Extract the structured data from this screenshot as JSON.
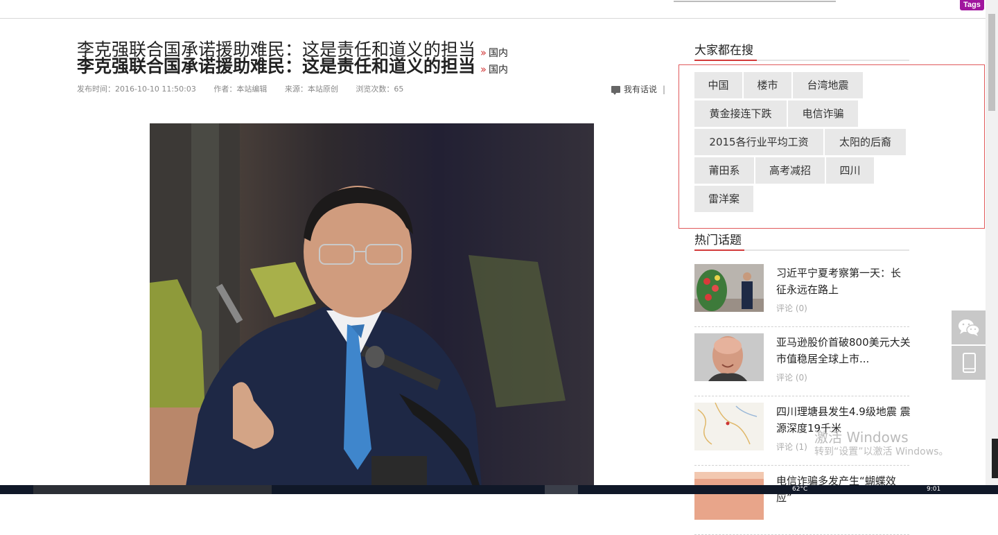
{
  "topbar": {
    "tags_label": "Tags"
  },
  "article": {
    "title": "李克强联合国承诺援助难民：这是责任和道义的担当",
    "category_label": "国内",
    "meta": {
      "publish_time": "发布时间：2016-10-10 11:50:03",
      "author": "作者：本站编辑",
      "source": "来源：本站原创",
      "views": "浏览次数：65"
    },
    "comment_link": "我有话说",
    "comment_sep": "|"
  },
  "sidebar": {
    "hot_search_title": "大家都在搜",
    "hot_tags": [
      "中国",
      "楼市",
      "台湾地震",
      "黄金接连下跌",
      "电信诈骗",
      "2015各行业平均工资",
      "太阳的后裔",
      "莆田系",
      "高考减招",
      "四川",
      "雷洋案"
    ],
    "hot_topics_title": "热门话题",
    "news": [
      {
        "headline": "习近平宁夏考察第一天：长征永远在路上",
        "comments": "评论 (0)"
      },
      {
        "headline": "亚马逊股价首破800美元大关 市值稳居全球上市...",
        "comments": "评论 (0)"
      },
      {
        "headline": "四川理塘县发生4.9级地震 震源深度19千米",
        "comments": "评论 (1)"
      },
      {
        "headline": "电信诈骗多发产生“蝴蝶效应”",
        "comments": ""
      }
    ]
  },
  "watermark": {
    "line1": "激活 Windows",
    "line2": "转到“设置”以激活 Windows。"
  },
  "taskbar": {
    "temperature": "62°C",
    "clock": "9:01"
  },
  "colors": {
    "accent_red": "#d23a3a",
    "tags_purple": "#a0169e",
    "tag_bg": "#e8e8e8",
    "box_border": "#e0585a"
  }
}
